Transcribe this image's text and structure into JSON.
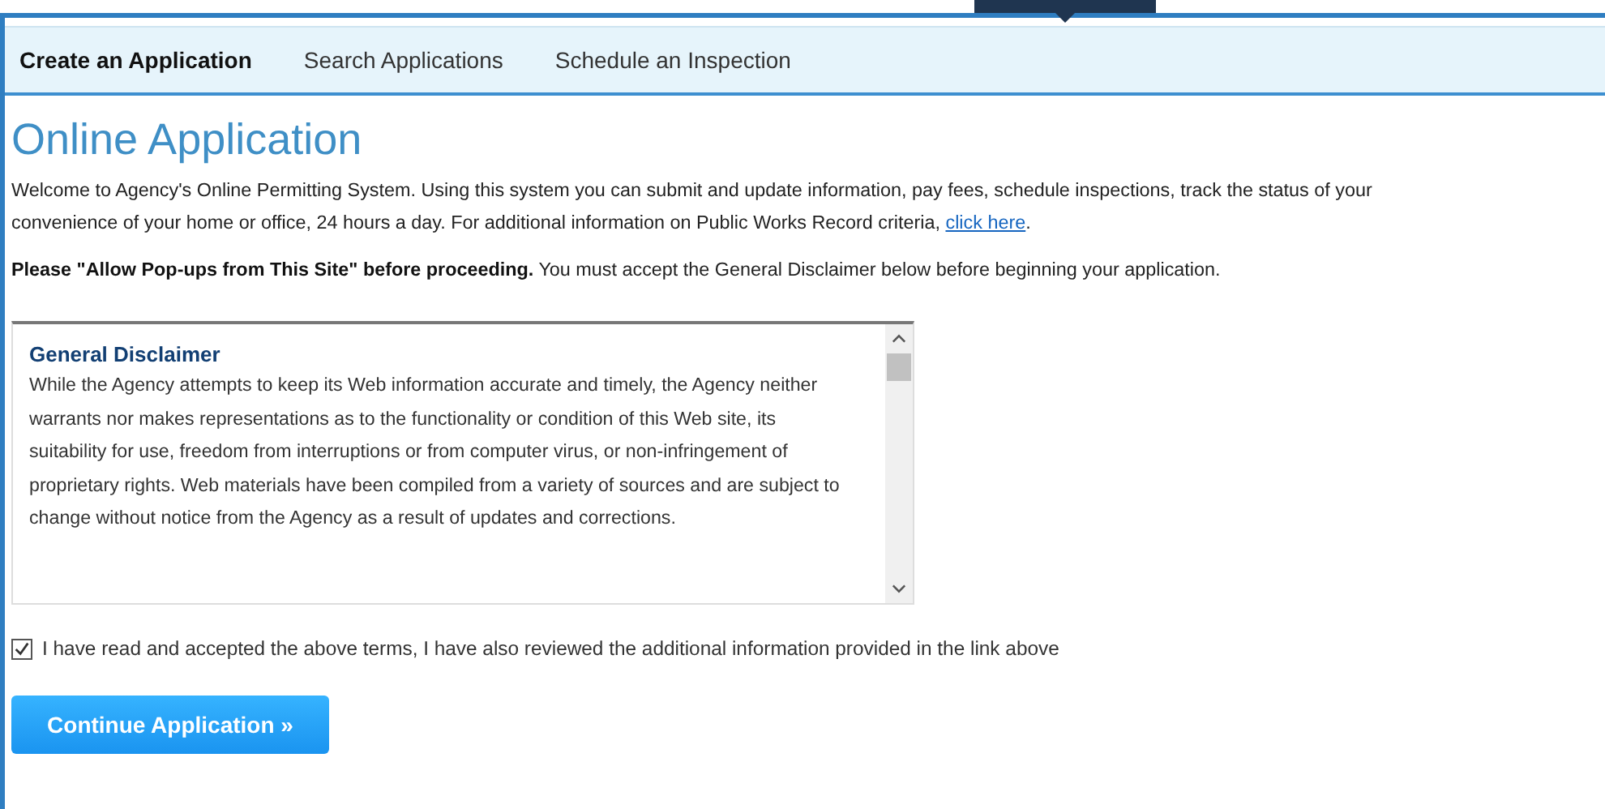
{
  "nav": {
    "tabs": [
      {
        "label": "Create an Application",
        "selected": true
      },
      {
        "label": "Search Applications",
        "selected": false
      },
      {
        "label": "Schedule an Inspection",
        "selected": false
      }
    ]
  },
  "heading": "Online Application",
  "intro": {
    "lines": [
      "Welcome to Agency's Online Permitting System. Using this system you can submit and update information, pay fees, schedule inspections, track the status of your",
      "convenience of your home or office, 24 hours a day.  For additional information on Public Works Record criteria, "
    ],
    "link": "click here",
    "after_link": "."
  },
  "notice": "**Please \"Allow Pop-ups from This Site\" before proceeding.** You must accept the General Disclaimer below before beginning your application.",
  "disclaimer": {
    "title": "General Disclaimer",
    "text": "While the Agency attempts to keep its Web information accurate and timely, the Agency neither warrants nor makes representations as to the functionality or condition of this Web site, its suitability for use, freedom from interruptions or from computer virus, or non-infringement of proprietary rights. Web materials have been compiled from a variety of sources and are subject to change without notice from the Agency as a result of updates and corrections."
  },
  "accept": {
    "label": "I have read and accepted the above terms, I have also reviewed the additional information provided in the link above",
    "checked": true
  },
  "continue_button": "Continue Application »"
}
